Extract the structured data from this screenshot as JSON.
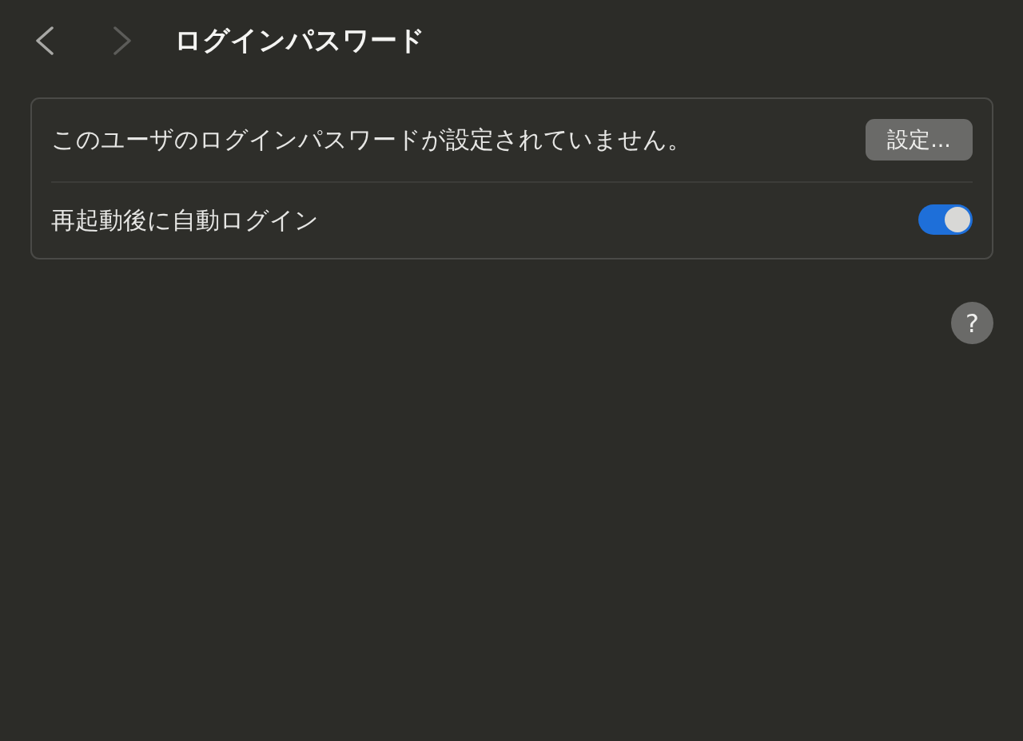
{
  "window": {
    "title": "ログインパスワード"
  },
  "nav": {
    "back": {
      "disabled": false
    },
    "forward": {
      "disabled": true
    }
  },
  "settings": [
    {
      "kind": "button",
      "label": "このユーザのログインパスワードが設定されていません。",
      "button": "設定..."
    },
    {
      "kind": "toggle",
      "label": "再起動後に自動ログイン",
      "on": true
    }
  ],
  "help_button": {
    "label": "?"
  }
}
